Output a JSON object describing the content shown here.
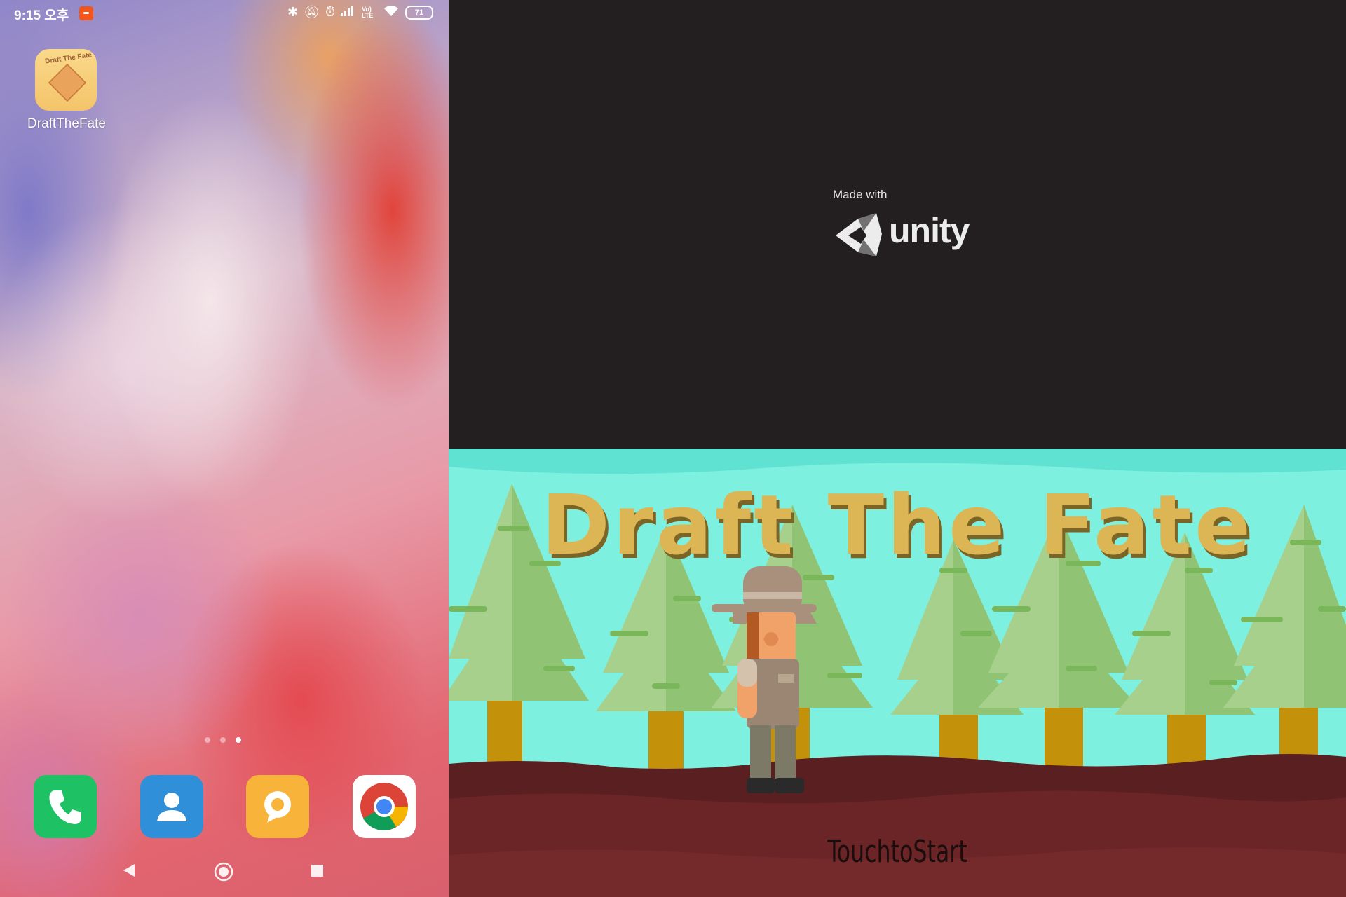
{
  "status_bar": {
    "time": "9:15 오후",
    "network": "Vo) LTE",
    "battery": "71"
  },
  "home": {
    "app": {
      "label": "DraftTheFate",
      "icon_text": "Draft The Fate"
    },
    "page_dots": [
      false,
      false,
      true
    ],
    "dock": [
      {
        "name": "phone-app-icon"
      },
      {
        "name": "contacts-app-icon"
      },
      {
        "name": "messaging-app-icon"
      },
      {
        "name": "chrome-app-icon"
      }
    ]
  },
  "unity_splash": {
    "made_with": "Made with",
    "brand": "unity",
    "background": "#231f20"
  },
  "game": {
    "title": "Draft The Fate",
    "prompt": "TouchtoStart",
    "colors": {
      "sky": "#7ef0e0",
      "ground": "#6b2527",
      "title": "#dcb555"
    }
  }
}
